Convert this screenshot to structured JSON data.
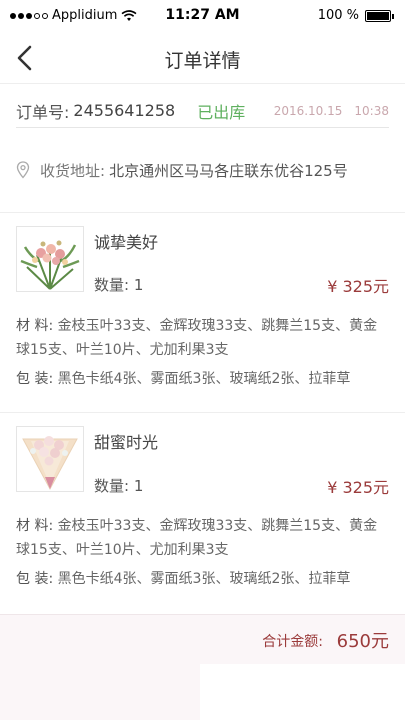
{
  "status_bar": {
    "carrier": "Applidium",
    "time": "11:27 AM",
    "battery_text": "100 %",
    "battery_level_percent": 100,
    "signal_bars": 3,
    "signal_total": 5
  },
  "nav": {
    "title": "订单详情",
    "back_icon": "chevron-left-icon"
  },
  "order": {
    "number_label": "订单号:",
    "number": "2455641258",
    "status": "已出库",
    "date": "2016.10.15",
    "time": "10:38"
  },
  "address": {
    "icon": "location-pin-icon",
    "label": "收货地址:",
    "value": "北京通州区马马各庄联东优谷125号"
  },
  "products": [
    {
      "name": "诚挚美好",
      "qty_label": "数量:",
      "qty": "1",
      "price": "¥ 325元",
      "material_label": "材 料:",
      "material": "金枝玉叶33支、金辉玫瑰33支、跳舞兰15支、黄金球15支、叶兰10片、尤加利果3支",
      "packaging_label": "包 装:",
      "packaging": "黑色卡纸4张、雾面纸3张、玻璃纸2张、拉菲草"
    },
    {
      "name": "甜蜜时光",
      "qty_label": "数量:",
      "qty": "1",
      "price": "¥ 325元",
      "material_label": "材 料:",
      "material": "金枝玉叶33支、金辉玫瑰33支、跳舞兰15支、黄金球15支、叶兰10片、尤加利果3支",
      "packaging_label": "包 装:",
      "packaging": "黑色卡纸4张、雾面纸3张、玻璃纸2张、拉菲草"
    }
  ],
  "total": {
    "label": "合计金额:",
    "value": "650元"
  },
  "colors": {
    "accent": "#9b3b3b",
    "status_green": "#5fb05f",
    "date_pink": "#c9a7ad"
  }
}
